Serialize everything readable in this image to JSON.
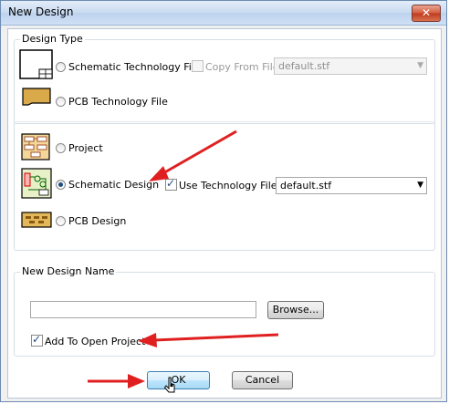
{
  "window": {
    "title": "New Design",
    "close_glyph": "✕"
  },
  "design_type": {
    "legend": "Design Type",
    "schematic_tech": {
      "label": "Schematic Technology File",
      "selected": false
    },
    "pcb_tech": {
      "label": "PCB Technology File",
      "selected": false
    },
    "copy_from_file": {
      "label": "Copy From File:",
      "checked": false,
      "value": "default.stf"
    }
  },
  "design_kind": {
    "project": {
      "label": "Project",
      "selected": false
    },
    "schematic_design": {
      "label": "Schematic Design",
      "selected": true
    },
    "pcb_design": {
      "label": "PCB Design",
      "selected": false
    },
    "use_tech_file": {
      "label": "Use Technology File:",
      "checked": true,
      "value": "default.stf"
    }
  },
  "design_name": {
    "legend": "New Design Name",
    "name_value": "",
    "browse_label": "Browse...",
    "add_to_project": {
      "label": "Add To Open Project",
      "checked": true
    }
  },
  "buttons": {
    "ok": "OK",
    "cancel": "Cancel"
  },
  "colors": {
    "annotation_arrow": "#e02020",
    "accent": "#1f4b84"
  },
  "check_glyph": "✓",
  "dropdown_glyph": "▼"
}
